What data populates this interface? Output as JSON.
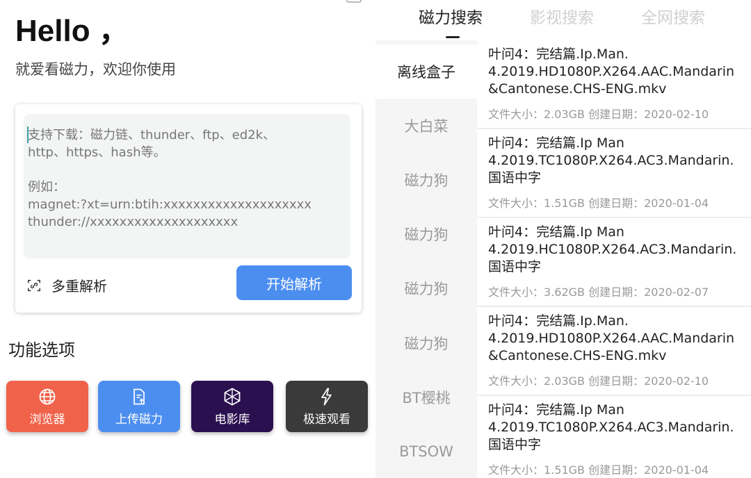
{
  "left": {
    "greeting": "Hello ，",
    "welcome": "就爱看磁力，欢迎你使用",
    "input_hint": "支持下载：磁力链、thunder、ftp、ed2k、\nhttp、https、hash等。\n\n例如：\nmagnet:?xt=urn:btih:xxxxxxxxxxxxxxxxxxxx\nthunder://xxxxxxxxxxxxxxxxxxxx",
    "multi_parse_label": "多重解析",
    "parse_button": "开始解析",
    "functions_title": "功能选项",
    "functions": [
      {
        "label": "浏览器",
        "icon": "globe-icon",
        "color": "#f0624a"
      },
      {
        "label": "上传磁力",
        "icon": "upload-file-icon",
        "color": "#4c8ef0"
      },
      {
        "label": "电影库",
        "icon": "cube-icon",
        "color": "#2b1050"
      },
      {
        "label": "极速观看",
        "icon": "lightning-icon",
        "color": "#3a3a3a"
      }
    ]
  },
  "right": {
    "tabs": [
      "磁力搜索",
      "影视搜索",
      "全网搜索"
    ],
    "active_tab": 0,
    "categories": [
      "离线盒子",
      "大白菜",
      "磁力狗",
      "磁力狗",
      "磁力狗",
      "磁力狗",
      "BT樱桃",
      "BTSOW"
    ],
    "active_category": 0,
    "results": [
      {
        "name": "叶问4：完结篇.Ip.Man.\n4.2019.HD1080P.X264.AAC.Mandarin\n&Cantonese.CHS-ENG.mkv",
        "meta": "文件大小：2.03GB 创建日期：2020-02-10"
      },
      {
        "name": "叶问4：完结篇.Ip Man\n4.2019.TC1080P.X264.AC3.Mandarin.\n国语中字",
        "meta": "文件大小：1.51GB 创建日期：2020-01-04"
      },
      {
        "name": "叶问4：完结篇.Ip Man\n4.2019.HC1080P.X264.AC3.Mandarin.\n国语中字",
        "meta": "文件大小：3.62GB 创建日期：2020-02-07"
      },
      {
        "name": "叶问4：完结篇.Ip.Man.\n4.2019.HD1080P.X264.AAC.Mandarin\n&Cantonese.CHS-ENG.mkv",
        "meta": "文件大小：2.03GB 创建日期：2020-02-10"
      },
      {
        "name": "叶问4：完结篇.Ip Man\n4.2019.TC1080P.X264.AC3.Mandarin.\n国语中字",
        "meta": "文件大小：1.51GB 创建日期：2020-01-04"
      }
    ]
  }
}
